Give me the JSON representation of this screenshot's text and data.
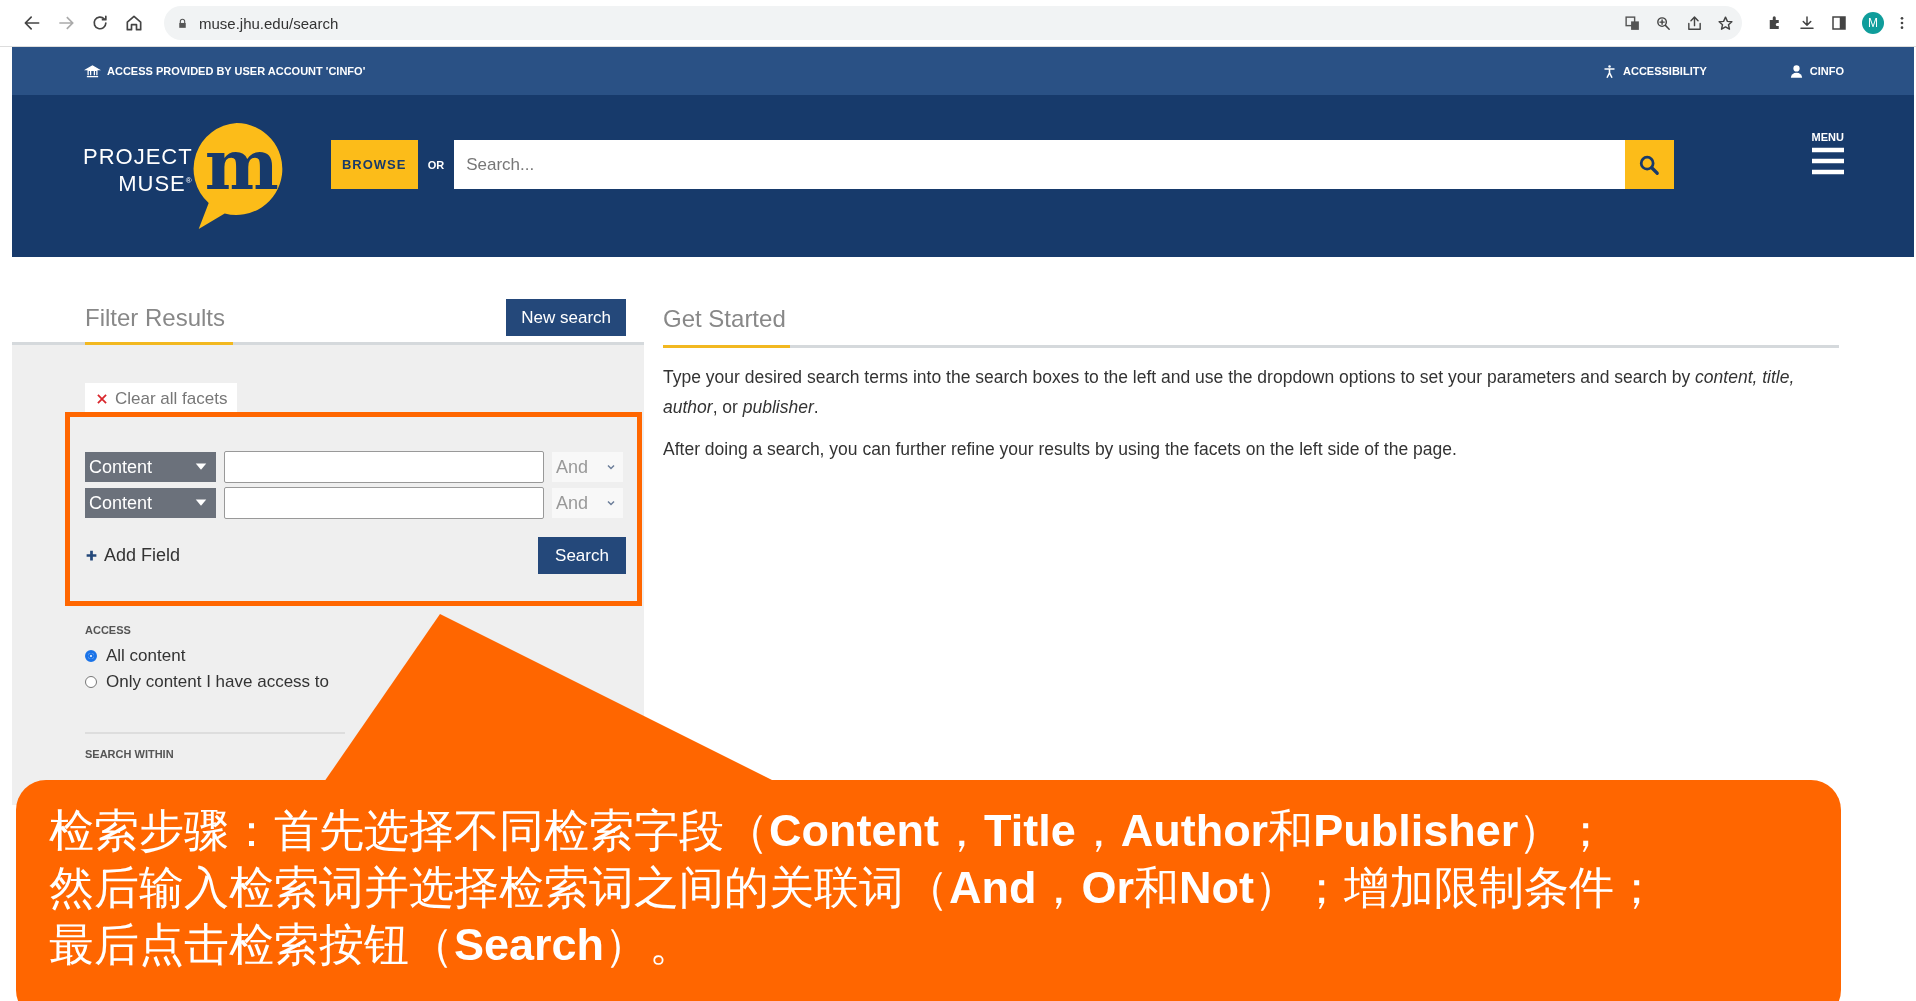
{
  "browser": {
    "url": "muse.jhu.edu/search",
    "profile_initial": "M"
  },
  "access_bar": {
    "notice": "ACCESS PROVIDED BY USER ACCOUNT 'CINFO'",
    "accessibility": "ACCESSIBILITY",
    "account": "CINFO"
  },
  "header": {
    "logo": {
      "line_1": "PROJECT",
      "line_2": "MUSE$^{®}$",
      "mark": "m"
    },
    "browse_button": "BROWSE",
    "or_label": "OR",
    "search": {
      "placeholder": "Search..."
    },
    "menu_label": "MENU"
  },
  "filter_panel": {
    "title": "Filter Results",
    "new_search_button": "New search",
    "clear_facets": "Clear all facets",
    "rows": [
      {
        "field": "Content",
        "operator": "And"
      },
      {
        "field": "Content",
        "operator": "And"
      }
    ],
    "add_field": "Add Field",
    "search_button": "Search",
    "access": {
      "heading": "ACCESS",
      "options": [
        {
          "label": "All content",
          "selected": true
        },
        {
          "label": "Only content I have access to",
          "selected": false
        }
      ]
    },
    "search_within_heading": "SEARCH WITHIN"
  },
  "get_started": {
    "title": "Get Started",
    "paragraphs": [
      "Type your desired search terms into the search boxes to the left and use the dropdown options to set your parameters and search by *content, title, author*, or *publisher*.",
      "After doing a search, you can further refine your results by using the facets on the left side of the page."
    ]
  },
  "annotation": {
    "lines": [
      "检索步骤：首先选择不同检索字段（**Content**，**Title**，**Author**和**Publisher**）；",
      "然后输入检索词并选择检索词之间的关联词（**And**，**Or**和**Not**）；增加限制条件；",
      "最后点击检索按钮（**Search**）。"
    ]
  }
}
